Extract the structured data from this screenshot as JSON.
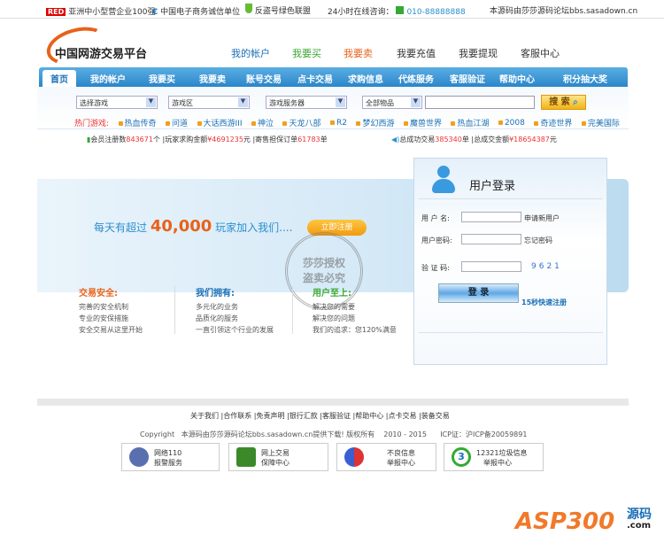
{
  "topbar": {
    "red": "RED",
    "item1": "亚洲中小型营企业100强",
    "item2": "中国电子商务诚信单位",
    "item3": "反盗号绿色联盟",
    "hotline_label": "24小时在线咨询：",
    "hotline": "010-88888888",
    "source": "本源码由莎莎源码论坛bbs.sasadown.cn"
  },
  "logo": "中国网游交易平台",
  "toplinks": [
    "我的帐户",
    "我要买",
    "我要卖",
    "我要充值",
    "我要提现",
    "客服中心"
  ],
  "nav": [
    "首页",
    "我的帐户",
    "我要买",
    "我要卖",
    "账号交易",
    "点卡交易",
    "求购信息",
    "代练服务",
    "客服验证",
    "帮助中心",
    "积分抽大奖"
  ],
  "search": {
    "game": "选择游戏",
    "area": "游戏区",
    "server": "游戏服务器",
    "type": "全部物品",
    "keyword": "",
    "button": "搜 索"
  },
  "hot": {
    "label": "热门游戏:",
    "games": [
      "热血传奇",
      "问道",
      "大话西游III",
      "神泣",
      "天龙八部",
      "R2",
      "梦幻西游",
      "魔兽世界",
      "热血江湖",
      "2008",
      "奇迹世界",
      "完美国际"
    ]
  },
  "stats": {
    "members_label": "会员注册数",
    "members": "843671",
    "members_unit": "个",
    "buy_label": "|玩家求购金额",
    "buy": "¥4691235",
    "buy_unit": "元",
    "orders_label": "|寄售担保订单",
    "orders": "61783",
    "orders_unit": "单",
    "deals_label": "总成功交易",
    "deals": "385340",
    "deals_unit": "单",
    "total_label": "|总成交金额",
    "total": "¥18654387",
    "total_unit": "元"
  },
  "banner": {
    "prefix": "每天有超过",
    "number": "40,000",
    "suffix": "玩家加入我们....",
    "register": "立即注册",
    "stamp1": "莎莎授权",
    "stamp2": "盗卖必究"
  },
  "columns": [
    {
      "title": "交易安全:",
      "items": [
        "完善的安全机制",
        "专业的安保措施",
        "安全交易从这里开始"
      ]
    },
    {
      "title": "我们拥有:",
      "items": [
        "多元化的业务",
        "品质化的服务",
        "一直引领这个行业的发展"
      ]
    },
    {
      "title": "用户至上:",
      "items": [
        "解决您的需要",
        "解决您的问题",
        "我们的追求：您120%满意"
      ]
    }
  ],
  "login": {
    "title": "用户登录",
    "user_label": "用 户 名:",
    "register": "申请新用户",
    "pwd_label": "用户密码:",
    "forgot": "忘记密码",
    "code_label": "验 证 码:",
    "code": "9621",
    "button": "登  录",
    "quick": "15秒快速注册"
  },
  "footer": {
    "links": [
      "关于我们",
      "合作联系",
      "免责声明",
      "银行汇款",
      "客服验证",
      "帮助中心",
      "点卡交易",
      "装备交易"
    ],
    "copyright": "Copyright   本源码由莎莎源码论坛bbs.sasadown.cn提供下载! 版权所有    2010 - 2015      ICP证：沪ICP备20059891",
    "badges": [
      [
        "网络110",
        "报警服务"
      ],
      [
        "网上交易",
        "保障中心"
      ],
      [
        "不良信息",
        "举报中心"
      ],
      [
        "12321垃圾信息",
        "举报中心"
      ]
    ]
  },
  "watermark": {
    "brand": "ASP300",
    "cn": "源码",
    "com": ".com"
  }
}
